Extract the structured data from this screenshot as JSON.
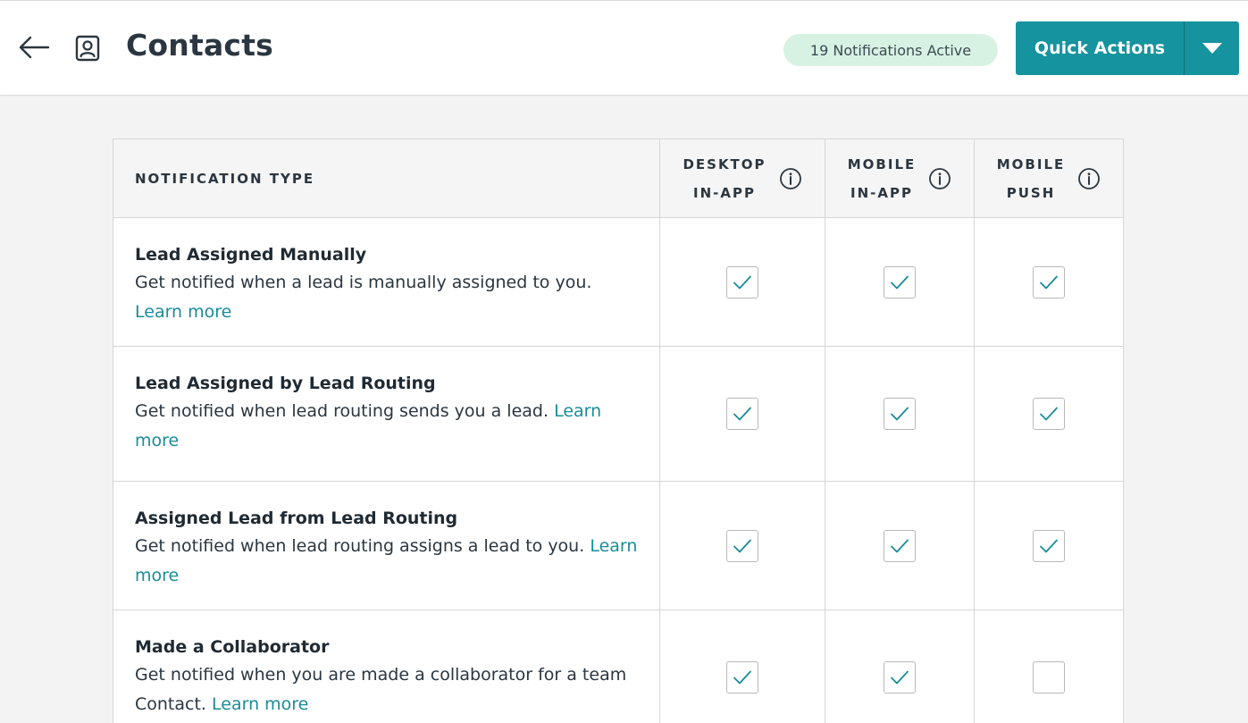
{
  "header": {
    "title": "Contacts",
    "notifications_badge": "19 Notifications Active",
    "quick_actions_label": "Quick Actions"
  },
  "colors": {
    "accent": "#15939e",
    "link": "#1a8c99",
    "badge_bg": "#d7f2e3",
    "check": "#1a8c99"
  },
  "icons": {
    "back": "arrow-left-icon",
    "contact": "contact-card-icon",
    "dropdown": "caret-down-icon",
    "info": "info-circle-icon",
    "check": "checkmark-icon"
  },
  "table": {
    "headers": {
      "type": "NOTIFICATION TYPE",
      "desktop_line1": "DESKTOP",
      "desktop_line2": "IN-APP",
      "mobile_line1": "MOBILE",
      "mobile_line2": "IN-APP",
      "push_line1": "MOBILE",
      "push_line2": "PUSH"
    },
    "rows": [
      {
        "title": "Lead Assigned Manually",
        "description": "Get notified when a lead is manually assigned to you.",
        "learn_more": "Learn more",
        "desktop_in_app": true,
        "mobile_in_app": true,
        "mobile_push": true
      },
      {
        "title": "Lead Assigned by Lead Routing",
        "description": "Get notified when lead routing sends you a lead.",
        "learn_more": "Learn more",
        "desktop_in_app": true,
        "mobile_in_app": true,
        "mobile_push": true
      },
      {
        "title": "Assigned Lead from Lead Routing",
        "description": "Get notified when lead routing assigns a lead to you.",
        "learn_more": "Learn more",
        "desktop_in_app": true,
        "mobile_in_app": true,
        "mobile_push": true
      },
      {
        "title": "Made a Collaborator",
        "description": "Get notified when you are made a collaborator for a team Contact.",
        "learn_more": "Learn more",
        "desktop_in_app": true,
        "mobile_in_app": true,
        "mobile_push": false
      }
    ]
  }
}
